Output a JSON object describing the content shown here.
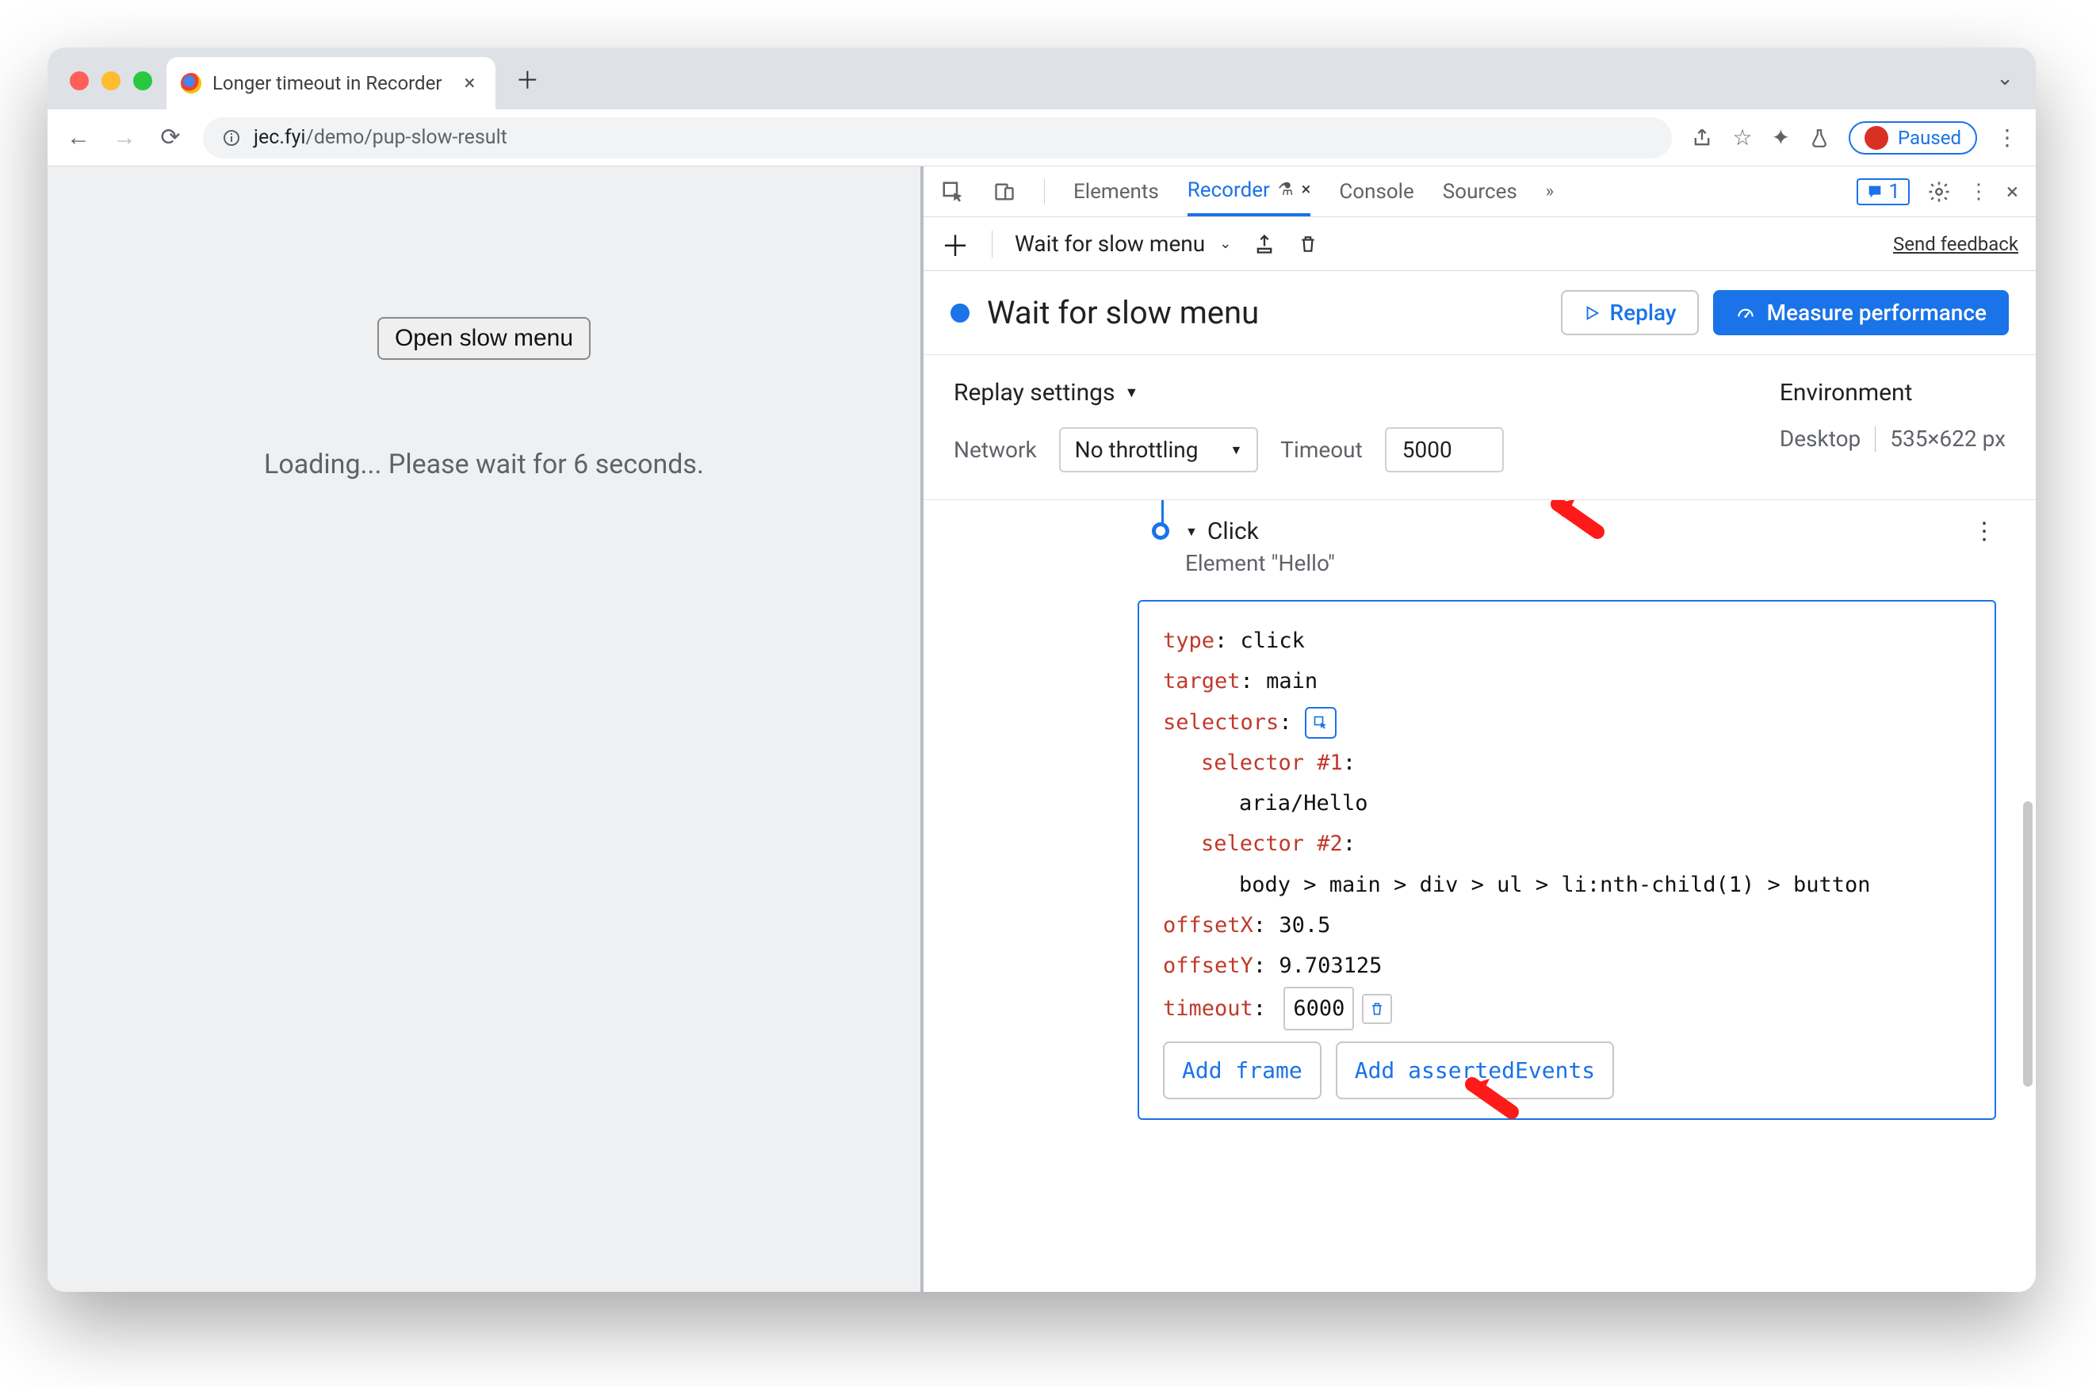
{
  "browser": {
    "tab_title": "Longer timeout in Recorder",
    "url_host": "jec.fyi",
    "url_path": "/demo/pup-slow-result",
    "paused_label": "Paused"
  },
  "page": {
    "button_label": "Open slow menu",
    "loading_text": "Loading... Please wait for 6 seconds."
  },
  "devtools": {
    "tabs": {
      "elements": "Elements",
      "recorder": "Recorder",
      "console": "Console",
      "sources": "Sources",
      "issues_count": "1"
    },
    "toolbar": {
      "recording_name": "Wait for slow menu",
      "send_feedback": "Send feedback"
    },
    "recording": {
      "title": "Wait for slow menu",
      "replay_label": "Replay",
      "measure_label": "Measure performance"
    },
    "settings": {
      "title": "Replay settings",
      "network_label": "Network",
      "network_value": "No throttling",
      "timeout_label": "Timeout",
      "timeout_value": "5000",
      "env_title": "Environment",
      "env_device": "Desktop",
      "env_viewport": "535×622 px"
    },
    "step": {
      "title": "Click",
      "subtitle": "Element \"Hello\"",
      "type_key": "type",
      "type_val": "click",
      "target_key": "target",
      "target_val": "main",
      "selectors_key": "selectors",
      "selector1_key": "selector #1",
      "selector1_val": "aria/Hello",
      "selector2_key": "selector #2",
      "selector2_val": "body > main > div > ul > li:nth-child(1) > button",
      "offsetx_key": "offsetX",
      "offsetx_val": "30.5",
      "offsety_key": "offsetY",
      "offsety_val": "9.703125",
      "timeout_key": "timeout",
      "timeout_val": "6000",
      "add_frame": "Add frame",
      "add_asserted": "Add assertedEvents"
    }
  }
}
